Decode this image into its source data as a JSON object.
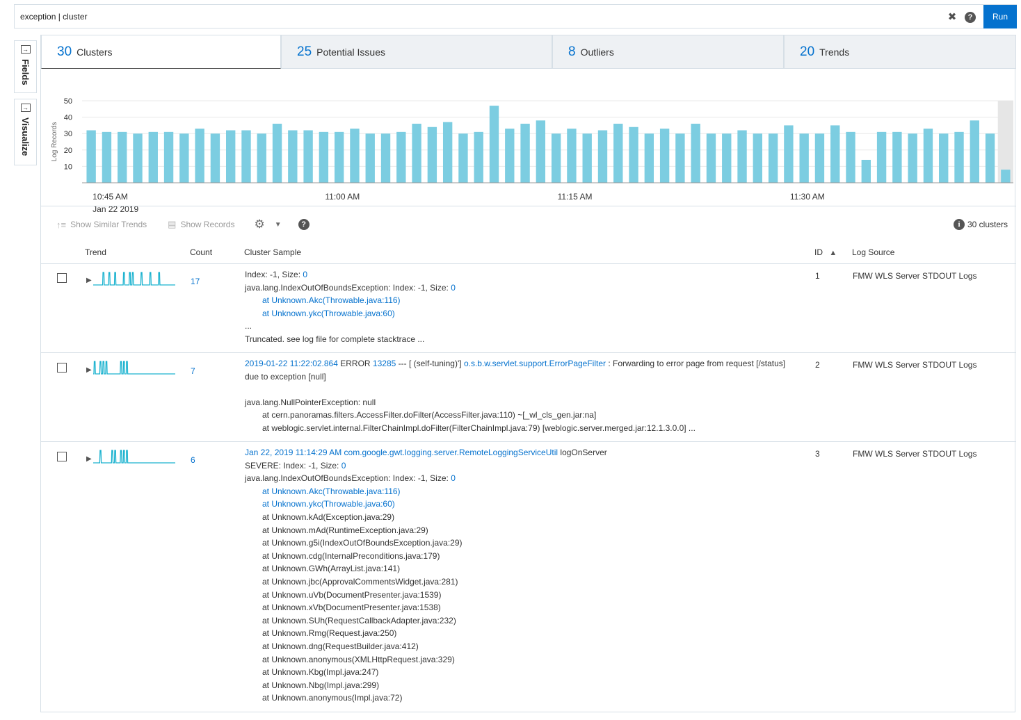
{
  "query": {
    "text": "exception | cluster",
    "run_label": "Run"
  },
  "rail": {
    "fields_label": "Fields",
    "visualize_label": "Visualize"
  },
  "tabs": [
    {
      "count": "30",
      "label": "Clusters"
    },
    {
      "count": "25",
      "label": "Potential Issues"
    },
    {
      "count": "8",
      "label": "Outliers"
    },
    {
      "count": "20",
      "label": "Trends"
    }
  ],
  "chart_data": {
    "type": "bar",
    "ylabel": "Log Records",
    "ylim": [
      0,
      50
    ],
    "yticks": [
      10,
      20,
      30,
      40,
      50
    ],
    "xticks": [
      {
        "label": "10:45 AM",
        "sublabel": "Jan 22 2019",
        "index": 0
      },
      {
        "label": "11:00 AM",
        "sublabel": "",
        "index": 15
      },
      {
        "label": "11:15 AM",
        "sublabel": "",
        "index": 30
      },
      {
        "label": "11:30 AM",
        "sublabel": "",
        "index": 45
      }
    ],
    "values": [
      32,
      31,
      31,
      30,
      31,
      31,
      30,
      33,
      30,
      32,
      32,
      30,
      36,
      32,
      32,
      31,
      31,
      33,
      30,
      30,
      31,
      36,
      34,
      37,
      30,
      31,
      47,
      33,
      36,
      38,
      30,
      33,
      30,
      32,
      36,
      34,
      30,
      33,
      30,
      36,
      30,
      30,
      32,
      30,
      30,
      35,
      30,
      30,
      35,
      31,
      14,
      31,
      31,
      30,
      33,
      30,
      31,
      38,
      30,
      8
    ],
    "highlight_last": true,
    "bar_color": "#7ccde1",
    "highlight_color": "#e6e6e6"
  },
  "toolbar": {
    "similar_label": "Show Similar Trends",
    "records_label": "Show Records",
    "summary": "30 clusters"
  },
  "columns": {
    "trend": "Trend",
    "count": "Count",
    "sample": "Cluster Sample",
    "id": "ID",
    "source": "Log Source"
  },
  "rows": [
    {
      "count": "17",
      "id": "1",
      "source": "FMW WLS Server STDOUT Logs",
      "spark": [
        0,
        0,
        0,
        1,
        0,
        1,
        0,
        1,
        0,
        0,
        1,
        0,
        1,
        1,
        0,
        0,
        1,
        0,
        0,
        1,
        0,
        0,
        1,
        0,
        0,
        0,
        0,
        0
      ],
      "lines": {
        "l1": "Index: -1, Size: ",
        "l1_v": "0",
        "l2": "java.lang.IndexOutOfBoundsException: Index: -1, Size: ",
        "l2_v": "0",
        "l3": "at Unknown.Akc(Throwable.java:116)",
        "l4": "at Unknown.ykc(Throwable.java:60)",
        "l5": "...",
        "l6": "Truncated. see log file for complete stacktrace ..."
      }
    },
    {
      "count": "7",
      "id": "2",
      "source": "FMW WLS Server STDOUT Logs",
      "spark": [
        1,
        0,
        1,
        1,
        1,
        0,
        0,
        0,
        0,
        1,
        1,
        1,
        0,
        0,
        0,
        0,
        0,
        0,
        0,
        0,
        0,
        0,
        0,
        0,
        0,
        0,
        0,
        0
      ],
      "lines": {
        "ts": "2019-01-22 11:22:02.864",
        "lvl": " ERROR ",
        "pid": "13285",
        "mid": " --- [ (self-tuning)'] ",
        "cls": "o.s.b.w.servlet.support.ErrorPageFilter",
        "msg": " : Forwarding to error page from request [/status] due to exception [null]",
        "l3": "java.lang.NullPointerException: null",
        "l4": "at cern.panoramas.filters.AccessFilter.doFilter(AccessFilter.java:110) ~[_wl_cls_gen.jar:na]",
        "l5": "at weblogic.servlet.internal.FilterChainImpl.doFilter(FilterChainImpl.java:79) [weblogic.server.merged.jar:12.1.3.0.0] ..."
      }
    },
    {
      "count": "6",
      "id": "3",
      "source": "FMW WLS Server STDOUT Logs",
      "spark": [
        0,
        0,
        1,
        0,
        0,
        0,
        1,
        1,
        0,
        1,
        1,
        1,
        0,
        0,
        0,
        0,
        0,
        0,
        0,
        0,
        0,
        0,
        0,
        0,
        0,
        0,
        0,
        0
      ],
      "lines": {
        "h1": "Jan 22, 2019 11:14:29 AM com.google.gwt.logging.server.RemoteLoggingServiceUtil",
        "h1b": " logOnServer",
        "h2": "SEVERE: Index: -1, Size: ",
        "h2_v": "0",
        "h3": "java.lang.IndexOutOfBoundsException: Index: -1, Size: ",
        "h3_v": "0",
        "s1": "at Unknown.Akc(Throwable.java:116)",
        "s2": "at Unknown.ykc(Throwable.java:60)",
        "stack": [
          "at Unknown.kAd(Exception.java:29)",
          "at Unknown.mAd(RuntimeException.java:29)",
          "at Unknown.g5i(IndexOutOfBoundsException.java:29)",
          "at Unknown.cdg(InternalPreconditions.java:179)",
          "at Unknown.GWh(ArrayList.java:141)",
          "at Unknown.jbc(ApprovalCommentsWidget.java:281)",
          "at Unknown.uVb(DocumentPresenter.java:1539)",
          "at Unknown.xVb(DocumentPresenter.java:1538)",
          "at Unknown.SUh(RequestCallbackAdapter.java:232)",
          "at Unknown.Rmg(Request.java:250)",
          "at Unknown.dng(RequestBuilder.java:412)",
          "at Unknown.anonymous(XMLHttpRequest.java:329)",
          "at Unknown.Kbg(Impl.java:247)",
          "at Unknown.Nbg(Impl.java:299)",
          "at Unknown.anonymous(Impl.java:72)"
        ]
      }
    }
  ]
}
